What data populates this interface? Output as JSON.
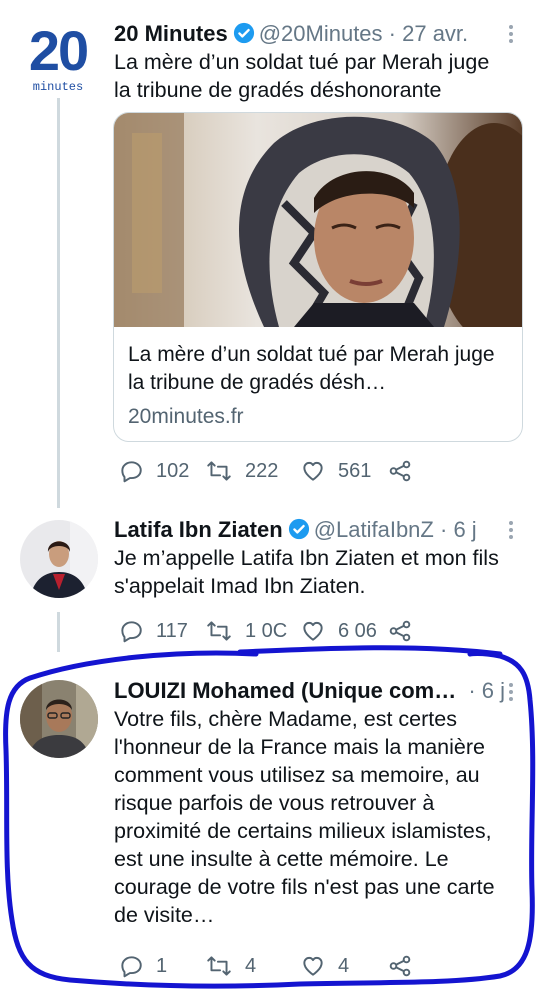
{
  "tweets": [
    {
      "name": "20 Minutes",
      "handle": "@20Minutes",
      "time": "· 27 avr.",
      "text": "La mère d’un soldat tué par Merah juge la tribune de gradés déshonorante",
      "avatar_logo": {
        "big": "20",
        "small": "minutes"
      },
      "card": {
        "title": "La mère d’un soldat tué par Merah juge la tribune de gradés désh…",
        "domain": "20minutes.fr"
      },
      "actions": {
        "replies": "102",
        "retweets": "222",
        "likes": "561"
      }
    },
    {
      "name": "Latifa Ibn Ziaten",
      "handle": "@LatifaIbnZ",
      "time": "· 6 j",
      "text": "Je m’appelle Latifa Ibn Ziaten et mon fils s'appelait Imad Ibn Ziaten.",
      "actions": {
        "replies": "117",
        "retweets": "1 0C",
        "likes": "6 06"
      }
    },
    {
      "name": "LOUIZI Mohamed (Unique com…",
      "handle": "",
      "time": "· 6 j",
      "text": "Votre fils, chère Madame, est certes l'honneur de la France mais la manière comment vous utilisez sa memoire, au risque parfois de vous retrouver à proximité de certains milieux islamistes, est une insulte à cette mémoire. Le courage de votre fils n'est pas une carte de visite…",
      "actions": {
        "replies": "1",
        "retweets": "4",
        "likes": "4"
      }
    }
  ],
  "colors": {
    "verified": "#1d9bf0",
    "annotation": "#1414d0",
    "logo": "#1f4ea3"
  },
  "icons": [
    "reply-icon",
    "retweet-icon",
    "like-icon",
    "share-icon",
    "verified-badge-icon",
    "more-icon"
  ]
}
